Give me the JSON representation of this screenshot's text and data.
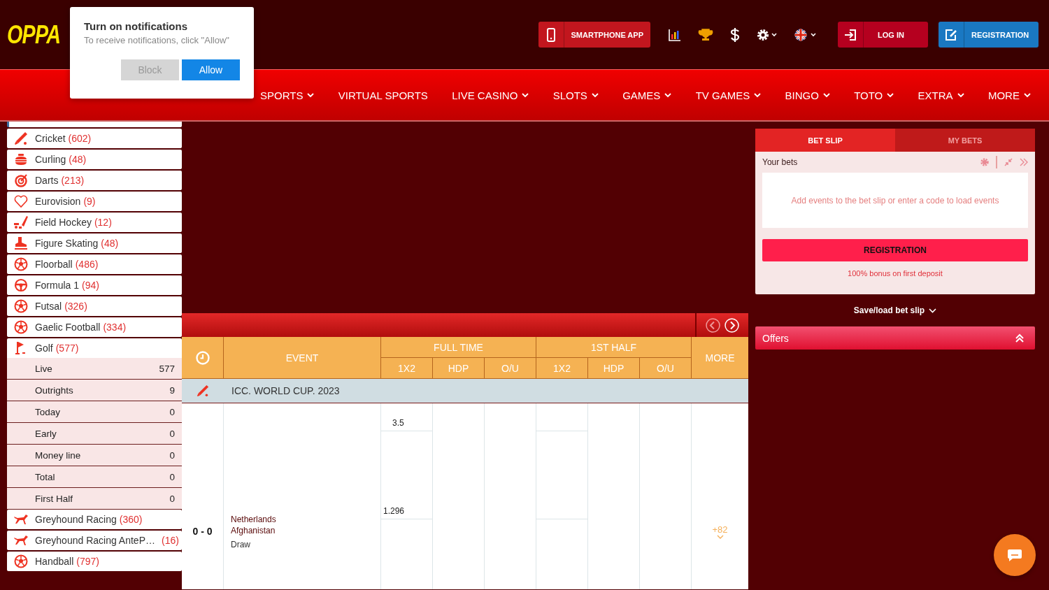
{
  "logo": "OPPA",
  "header": {
    "app_button": "SMARTPHONE APP",
    "login": "LOG IN",
    "registration": "REGISTRATION"
  },
  "nav": [
    {
      "label": "SPORTS",
      "dropdown": true
    },
    {
      "label": "VIRTUAL SPORTS",
      "dropdown": false
    },
    {
      "label": "LIVE CASINO",
      "dropdown": true
    },
    {
      "label": "SLOTS",
      "dropdown": true
    },
    {
      "label": "GAMES",
      "dropdown": true
    },
    {
      "label": "TV GAMES",
      "dropdown": true
    },
    {
      "label": "BINGO",
      "dropdown": true
    },
    {
      "label": "TOTO",
      "dropdown": true
    },
    {
      "label": "EXTRA",
      "dropdown": true
    },
    {
      "label": "MORE",
      "dropdown": true
    }
  ],
  "notification": {
    "title": "Turn on notifications",
    "message": "To receive notifications, click \"Allow\"",
    "buttons": [
      {
        "label": "Block",
        "primary": false
      },
      {
        "label": "Allow",
        "primary": true
      }
    ]
  },
  "sidebar": {
    "sports": [
      {
        "name": "Cricket",
        "count": "(602)",
        "expanded": false
      },
      {
        "name": "Curling",
        "count": "(48)",
        "expanded": false
      },
      {
        "name": "Darts",
        "count": "(213)",
        "expanded": false
      },
      {
        "name": "Eurovision",
        "count": "(9)",
        "expanded": false
      },
      {
        "name": "Field Hockey",
        "count": "(12)",
        "expanded": false
      },
      {
        "name": "Figure Skating",
        "count": "(48)",
        "expanded": false
      },
      {
        "name": "Floorball",
        "count": "(486)",
        "expanded": false
      },
      {
        "name": "Formula 1",
        "count": "(94)",
        "expanded": false
      },
      {
        "name": "Futsal",
        "count": "(326)",
        "expanded": false
      },
      {
        "name": "Gaelic Football",
        "count": "(334)",
        "expanded": false
      },
      {
        "name": "Golf",
        "count": "(577)",
        "expanded": true,
        "children": [
          {
            "name": "Live",
            "count": "577"
          },
          {
            "name": "Outrights",
            "count": "9"
          },
          {
            "name": "Today",
            "count": "0"
          },
          {
            "name": "Early",
            "count": "0"
          },
          {
            "name": "Money line",
            "count": "0"
          },
          {
            "name": "Total",
            "count": "0"
          },
          {
            "name": "First Half",
            "count": "0"
          }
        ]
      },
      {
        "name": "Greyhound Racing",
        "count": "(360)",
        "expanded": false
      },
      {
        "name": "Greyhound Racing AnteP…",
        "count": "(16)",
        "expanded": false
      },
      {
        "name": "Handball",
        "count": "(797)",
        "expanded": false
      }
    ]
  },
  "table": {
    "event_heading": "EVENT",
    "groups": [
      {
        "label": "FULL TIME",
        "columns": [
          "1X2",
          "HDP",
          "O/U"
        ]
      },
      {
        "label": "1ST HALF",
        "columns": [
          "1X2",
          "HDP",
          "O/U"
        ]
      }
    ],
    "more_heading": "MORE",
    "league": "ICC. WORLD CUP. 2023",
    "event": {
      "score": "0 - 0",
      "teams": [
        "Netherlands",
        "Afghanistan"
      ],
      "draw": "Draw",
      "odds": [
        "3.5",
        "1.296"
      ],
      "more": "+82"
    }
  },
  "betslip": {
    "tabs": [
      {
        "label": "BET SLIP",
        "selected": true
      },
      {
        "label": "MY BETS",
        "selected": false
      }
    ],
    "your_bets": "Your bets",
    "empty_message": "Add events to the bet slip or enter a code to load events",
    "register_button": "REGISTRATION",
    "bonus": "100% bonus on first deposit",
    "save_load": "Save/load bet slip",
    "offers": "Offers"
  }
}
